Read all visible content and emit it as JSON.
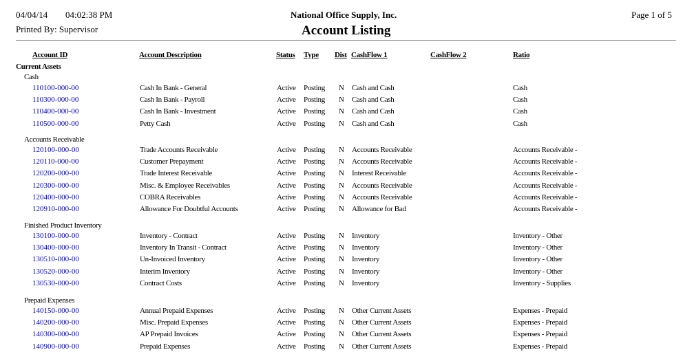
{
  "header": {
    "date": "04/04/14",
    "time": "04:02:38 PM",
    "printed_by": "Printed By: Supervisor",
    "company": "National Office Supply, Inc.",
    "title": "Account Listing",
    "page": "Page 1 of 5"
  },
  "columns": {
    "account_id": "Account ID",
    "description": "Account Description",
    "status": "Status",
    "type": "Type",
    "dist": "Dist",
    "cashflow1": "CashFlow 1",
    "cashflow2": "CashFlow 2",
    "ratio": "Ratio"
  },
  "colors": {
    "link": "#0000cc",
    "rule": "#808080"
  },
  "section": "Current Assets",
  "groups": [
    {
      "name": "Cash",
      "rows": [
        {
          "id": "110100-000-00",
          "desc": "Cash In Bank - General",
          "status": "Active",
          "type": "Posting",
          "dist": "N",
          "cf1": "Cash and Cash",
          "cf2": "",
          "ratio": "Cash"
        },
        {
          "id": "110300-000-00",
          "desc": "Cash In Bank - Payroll",
          "status": "Active",
          "type": "Posting",
          "dist": "N",
          "cf1": "Cash and Cash",
          "cf2": "",
          "ratio": "Cash"
        },
        {
          "id": "110400-000-00",
          "desc": "Cash In Bank - Investment",
          "status": "Active",
          "type": "Posting",
          "dist": "N",
          "cf1": "Cash and Cash",
          "cf2": "",
          "ratio": "Cash"
        },
        {
          "id": "110500-000-00",
          "desc": "Petty Cash",
          "status": "Active",
          "type": "Posting",
          "dist": "N",
          "cf1": "Cash and Cash",
          "cf2": "",
          "ratio": "Cash"
        }
      ]
    },
    {
      "name": "Accounts Receivable",
      "rows": [
        {
          "id": "120100-000-00",
          "desc": "Trade Accounts Receivable",
          "status": "Active",
          "type": "Posting",
          "dist": "N",
          "cf1": "Accounts Receivable",
          "cf2": "",
          "ratio": "Accounts Receivable -"
        },
        {
          "id": "120110-000-00",
          "desc": "Customer Prepayment",
          "status": "Active",
          "type": "Posting",
          "dist": "N",
          "cf1": "Accounts Receivable",
          "cf2": "",
          "ratio": "Accounts Receivable -"
        },
        {
          "id": "120200-000-00",
          "desc": "Trade Interest Receivable",
          "status": "Active",
          "type": "Posting",
          "dist": "N",
          "cf1": "Interest Receivable",
          "cf2": "",
          "ratio": "Accounts Receivable -"
        },
        {
          "id": "120300-000-00",
          "desc": "Misc. & Employee Receivables",
          "status": "Active",
          "type": "Posting",
          "dist": "N",
          "cf1": "Accounts Receivable",
          "cf2": "",
          "ratio": "Accounts Receivable -"
        },
        {
          "id": "120400-000-00",
          "desc": "COBRA Receivables",
          "status": "Active",
          "type": "Posting",
          "dist": "N",
          "cf1": "Accounts Receivable",
          "cf2": "",
          "ratio": "Accounts Receivable -"
        },
        {
          "id": "120910-000-00",
          "desc": "Allowance For Doubtful Accounts",
          "status": "Active",
          "type": "Posting",
          "dist": "N",
          "cf1": "Allowance for Bad",
          "cf2": "",
          "ratio": "Accounts Receivable -"
        }
      ]
    },
    {
      "name": "Finished Product Inventory",
      "rows": [
        {
          "id": "130100-000-00",
          "desc": "Inventory - Contract",
          "status": "Active",
          "type": "Posting",
          "dist": "N",
          "cf1": "Inventory",
          "cf2": "",
          "ratio": "Inventory - Other"
        },
        {
          "id": "130400-000-00",
          "desc": "Inventory In Transit - Contract",
          "status": "Active",
          "type": "Posting",
          "dist": "N",
          "cf1": "Inventory",
          "cf2": "",
          "ratio": "Inventory - Other"
        },
        {
          "id": "130510-000-00",
          "desc": "Un-Invoiced Inventory",
          "status": "Active",
          "type": "Posting",
          "dist": "N",
          "cf1": "Inventory",
          "cf2": "",
          "ratio": "Inventory - Other"
        },
        {
          "id": "130520-000-00",
          "desc": "Interim Inventory",
          "status": "Active",
          "type": "Posting",
          "dist": "N",
          "cf1": "Inventory",
          "cf2": "",
          "ratio": "Inventory - Other"
        },
        {
          "id": "130530-000-00",
          "desc": "Contract Costs",
          "status": "Active",
          "type": "Posting",
          "dist": "N",
          "cf1": "Inventory",
          "cf2": "",
          "ratio": "Inventory - Supplies"
        }
      ]
    },
    {
      "name": "Prepaid Expenses",
      "rows": [
        {
          "id": "140150-000-00",
          "desc": "Annual Prepaid Expenses",
          "status": "Active",
          "type": "Posting",
          "dist": "N",
          "cf1": "Other Current Assets",
          "cf2": "",
          "ratio": "Expenses - Prepaid"
        },
        {
          "id": "140200-000-00",
          "desc": "Misc. Prepaid Expenses",
          "status": "Active",
          "type": "Posting",
          "dist": "N",
          "cf1": "Other Current Assets",
          "cf2": "",
          "ratio": "Expenses - Prepaid"
        },
        {
          "id": "140300-000-00",
          "desc": "AP Prepaid Invoices",
          "status": "Active",
          "type": "Posting",
          "dist": "N",
          "cf1": "Other Current Assets",
          "cf2": "",
          "ratio": "Expenses - Prepaid"
        },
        {
          "id": "140900-000-00",
          "desc": "Prepaid Expenses",
          "status": "Active",
          "type": "Posting",
          "dist": "N",
          "cf1": "Other Current Assets",
          "cf2": "",
          "ratio": "Expenses - Prepaid"
        }
      ]
    }
  ]
}
